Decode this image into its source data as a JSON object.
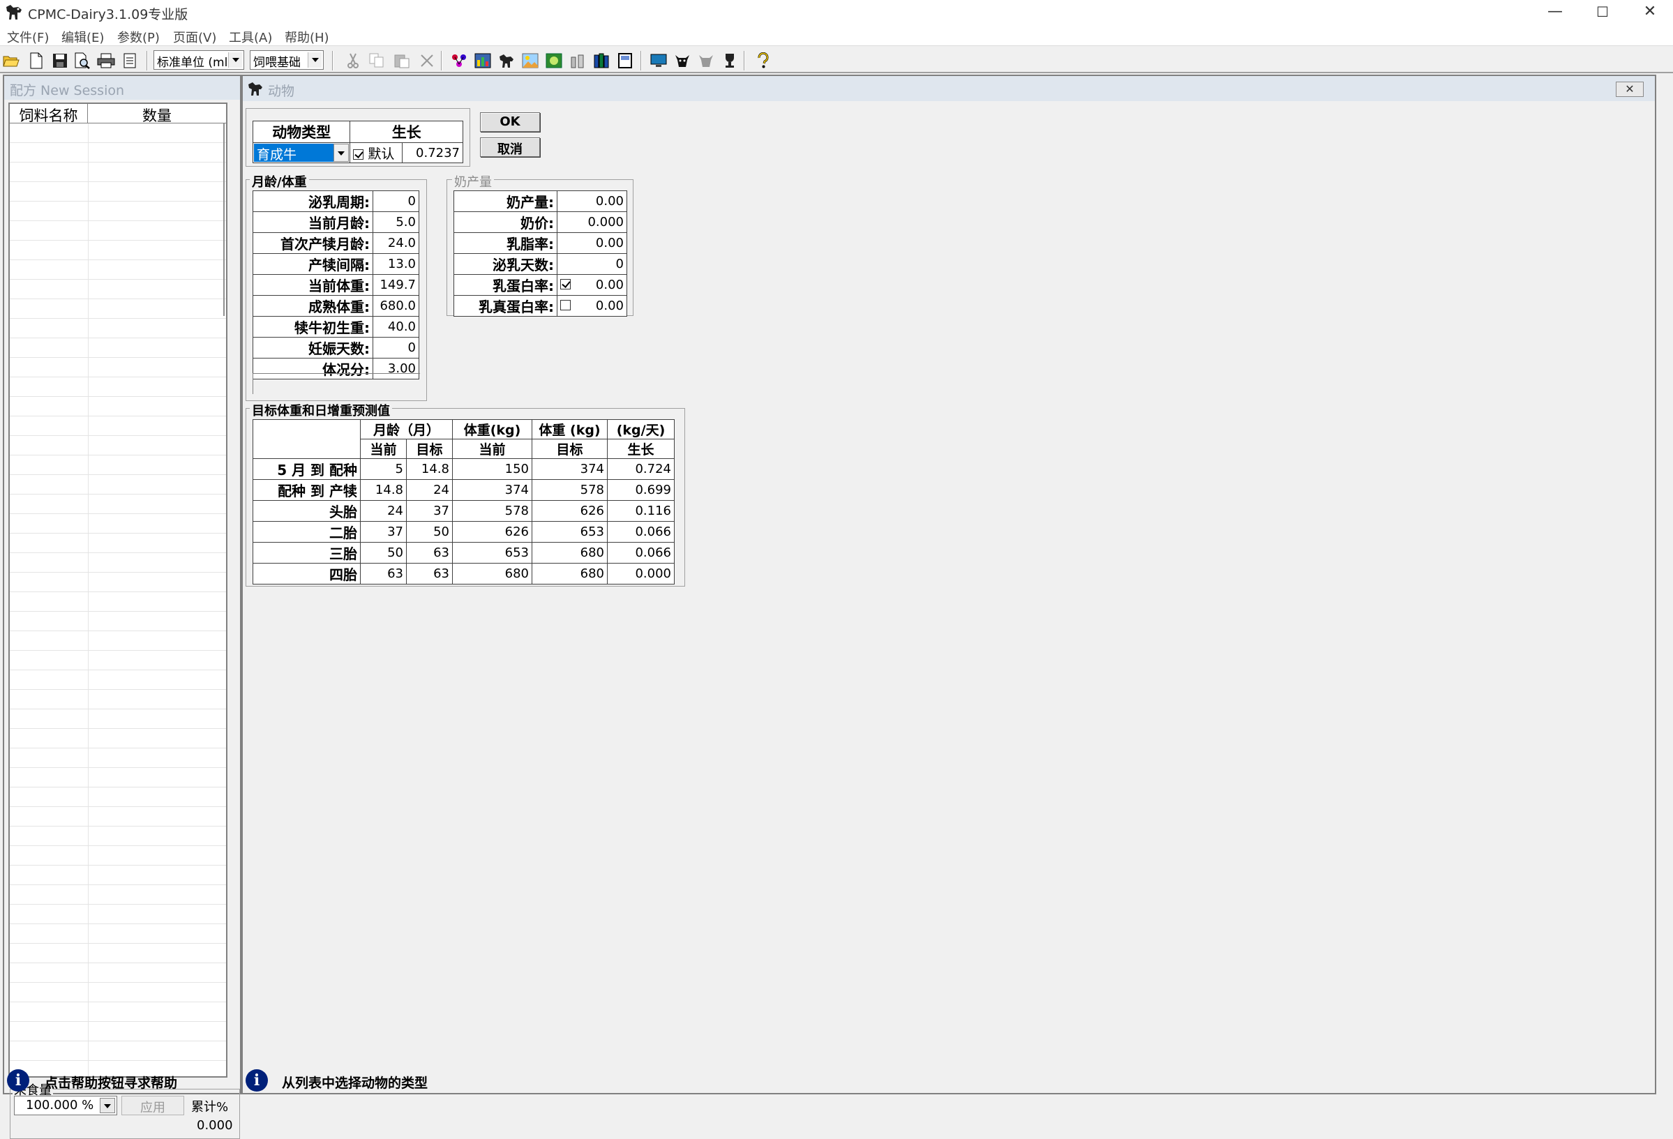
{
  "window": {
    "title": "CPMC-Dairy3.1.09专业版",
    "controls": {
      "minimize": "—",
      "maximize": "☐",
      "close": "✕"
    }
  },
  "menu": [
    "文件(F)",
    "编辑(E)",
    "参数(P)",
    "页面(V)",
    "工具(A)",
    "帮助(H)"
  ],
  "toolbar": {
    "unit_combo": "标准单位 (ml",
    "basis_combo": "饲喂基础"
  },
  "left_panel": {
    "caption": "配方 New Session",
    "columns": [
      "饲料名称",
      "数量"
    ],
    "intake": {
      "title": "采食量",
      "value": "100.000 %",
      "apply_label": "应用",
      "cumulative_label": "累计%",
      "cumulative_value": "0.000"
    },
    "status": "点击帮助按钮寻求帮助"
  },
  "animal_window": {
    "caption": "动物",
    "close_label": "✕",
    "type_header": "动物类型",
    "growth_header": "生长",
    "type_value": "育成牛",
    "default_label": "默认",
    "default_checked": true,
    "growth_value": "0.7237",
    "ok_label": "OK",
    "cancel_label": "取消",
    "age_weight": {
      "title": "月龄/体重",
      "rows": [
        {
          "label": "泌乳周期:",
          "value": "0"
        },
        {
          "label": "当前月龄:",
          "value": "5.0"
        },
        {
          "label": "首次产犊月龄:",
          "value": "24.0"
        },
        {
          "label": "产犊间隔:",
          "value": "13.0"
        },
        {
          "label": "当前体重:",
          "value": "149.7"
        },
        {
          "label": "成熟体重:",
          "value": "680.0"
        },
        {
          "label": "犊牛初生重:",
          "value": "40.0"
        },
        {
          "label": "妊娠天数:",
          "value": "0"
        },
        {
          "label": "体况分:",
          "value": "3.00"
        }
      ]
    },
    "milk": {
      "title": "奶产量",
      "rows": [
        {
          "label": "奶产量:",
          "value": "0.00"
        },
        {
          "label": "奶价:",
          "value": "0.000"
        },
        {
          "label": "乳脂率:",
          "value": "0.00"
        },
        {
          "label": "泌乳天数:",
          "value": "0"
        },
        {
          "label": "乳蛋白率:",
          "value": "0.00",
          "checked": true
        },
        {
          "label": "乳真蛋白率:",
          "value": "0.00",
          "checked": false
        }
      ]
    },
    "target": {
      "title": "目标体重和日增重预测值",
      "header1": [
        "月龄（月）",
        "体重(kg)",
        "体重 (kg)",
        "(kg/天)"
      ],
      "header2": [
        "当前",
        "目标",
        "当前",
        "目标",
        "生长"
      ],
      "rows": [
        {
          "label": "5 月 到 配种",
          "cells": [
            "5",
            "14.8",
            "150",
            "374",
            "0.724"
          ]
        },
        {
          "label": "配种 到 产犊",
          "cells": [
            "14.8",
            "24",
            "374",
            "578",
            "0.699"
          ]
        },
        {
          "label": "头胎",
          "cells": [
            "24",
            "37",
            "578",
            "626",
            "0.116"
          ]
        },
        {
          "label": "二胎",
          "cells": [
            "37",
            "50",
            "626",
            "653",
            "0.066"
          ]
        },
        {
          "label": "三胎",
          "cells": [
            "50",
            "63",
            "653",
            "680",
            "0.066"
          ]
        },
        {
          "label": "四胎",
          "cells": [
            "63",
            "63",
            "680",
            "680",
            "0.000"
          ]
        }
      ]
    },
    "status": "从列表中选择动物的类型"
  }
}
